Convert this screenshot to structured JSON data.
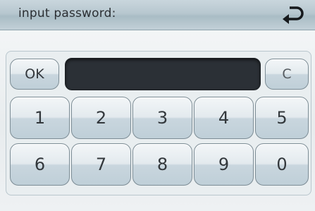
{
  "header": {
    "title": "input password:"
  },
  "icons": {
    "back": "return-arrow-icon"
  },
  "keypad": {
    "ok_label": "OK",
    "clear_label": "C",
    "password_value": "",
    "digits": [
      "1",
      "2",
      "3",
      "4",
      "5",
      "6",
      "7",
      "8",
      "9",
      "0"
    ]
  },
  "colors": {
    "title_bar": "#b7c7cf",
    "display_bg": "#2b3036",
    "key_face": "#d6e0e6"
  }
}
